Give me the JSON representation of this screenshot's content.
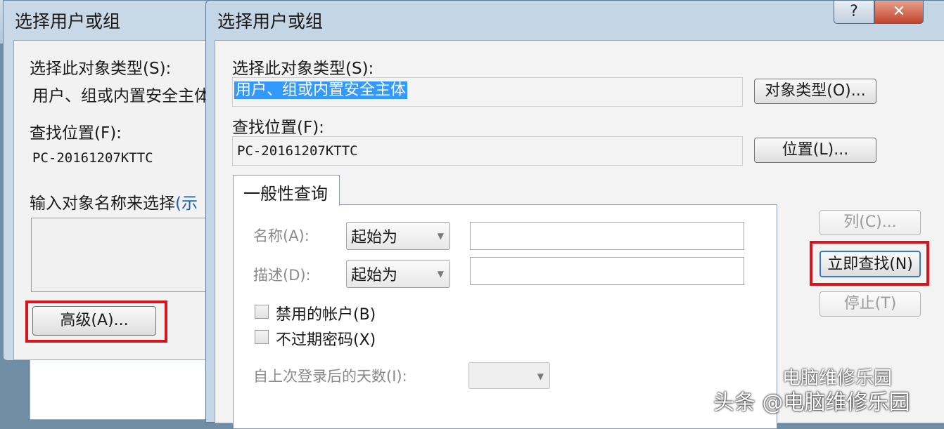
{
  "back_dialog": {
    "title": "选择用户或组",
    "object_type_label": "选择此对象类型(S):",
    "object_type_value": "用户、组或内置安全主体",
    "location_label": "查找位置(F):",
    "location_value": "PC-20161207KTTC",
    "enter_names_label": "输入对象名称来选择",
    "examples_link": "(示",
    "advanced_button": "高级(A)..."
  },
  "front_dialog": {
    "title": "选择用户或组",
    "help_label": "?",
    "close_label": "✕",
    "object_type_label": "选择此对象类型(S):",
    "object_type_value": "用户、组或内置安全主体",
    "object_types_button": "对象类型(O)...",
    "location_label": "查找位置(F):",
    "location_value": "PC-20161207KTTC",
    "locations_button": "位置(L)...",
    "tab_label": "一般性查询",
    "name_label": "名称(A):",
    "name_combo": "起始为",
    "description_label": "描述(D):",
    "description_combo": "起始为",
    "disabled_accounts": "禁用的帐户(B)",
    "non_expiring_passwords": "不过期密码(X)",
    "days_since_logon_label": "自上次登录后的天数(I):",
    "columns_button": "列(C)...",
    "find_now_button": "立即查找(N)",
    "stop_button": "停止(T)"
  },
  "watermark": {
    "line1": "电脑维修乐园",
    "line2": "头条 @电脑维修乐园"
  },
  "colors": {
    "highlight_red": "#d8141c",
    "selection_blue": "#3399ff"
  }
}
